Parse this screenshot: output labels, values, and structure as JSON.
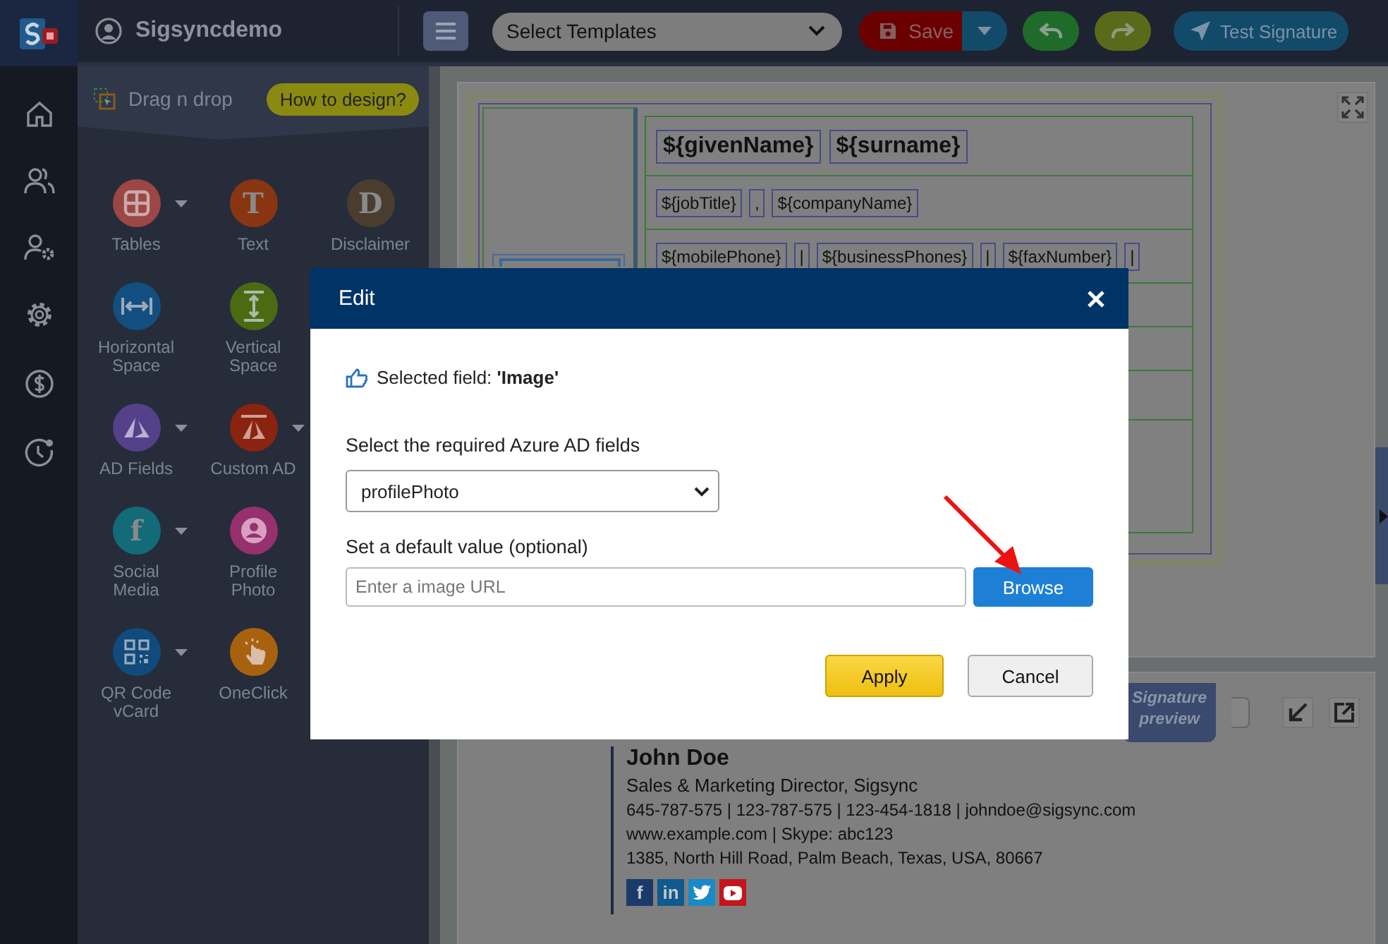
{
  "app": {
    "name": "Sigsyncdemo"
  },
  "toolbar": {
    "template_select": "Select Templates",
    "save": "Save",
    "test": "Test Signature"
  },
  "palette": {
    "title": "Drag n drop",
    "help": "How to design?",
    "items": [
      {
        "label": "Tables",
        "kind": "table",
        "color": "#9c4646",
        "has_menu": true
      },
      {
        "label": "Text",
        "kind": "glyph",
        "glyph": "T",
        "color": "#8a3512",
        "has_menu": false
      },
      {
        "label": "Disclaimer",
        "kind": "glyph",
        "glyph": "D",
        "color": "#4a3d30",
        "has_menu": false
      },
      {
        "label": "Horizontal Space",
        "kind": "horizontal",
        "color": "#124f80",
        "has_menu": false
      },
      {
        "label": "Vertical Space",
        "kind": "vertical",
        "color": "#4a6b12",
        "has_menu": false
      },
      {
        "label": "AD Fields",
        "kind": "azure",
        "color": "#54418a",
        "has_menu": true
      },
      {
        "label": "Custom AD",
        "kind": "custom-azure",
        "color": "#8a2410",
        "has_menu": true
      },
      {
        "label": "Social Media",
        "kind": "glyph",
        "glyph": "f",
        "color": "#136a78",
        "has_menu": true
      },
      {
        "label": "Profile Photo",
        "kind": "profile",
        "color": "#96306e",
        "has_menu": false
      },
      {
        "label": "QR Code vCard",
        "kind": "qr",
        "color": "#114a7c",
        "has_menu": true
      },
      {
        "label": "OneClick",
        "kind": "click",
        "color": "#a8620f",
        "has_menu": false
      }
    ]
  },
  "editor": {
    "rows": [
      {
        "kind": "name",
        "tokens": [
          "${givenName}",
          "${surname}"
        ]
      },
      {
        "kind": "detail",
        "tokens": [
          "${jobTitle}",
          ",",
          "${companyName}"
        ]
      },
      {
        "kind": "detail",
        "tokens": [
          "${mobilePhone}",
          "|",
          "${businessPhones}",
          "|",
          "${faxNumber}",
          "|"
        ]
      }
    ]
  },
  "modal": {
    "title": "Edit",
    "selected": "Selected field: **'Image'**",
    "select_label": "Select the required Azure AD fields",
    "select_value": "profilePhoto",
    "default_label": "Set a default value (optional)",
    "placeholder": "Enter a image URL",
    "browse": "Browse",
    "apply": "Apply",
    "cancel": "Cancel"
  },
  "preview": {
    "ribbon": "Signature preview",
    "name": "John Doe",
    "title": "Sales & Marketing Director, Sigsync",
    "lines": [
      "645-787-575 | 123-787-575 | 123-454-1818 | johndoe@sigsync.com",
      "www.example.com | Skype: abc123",
      "1385, North Hill Road, Palm Beach, Texas, USA, 80667"
    ],
    "social": [
      {
        "kind": "facebook",
        "glyph": "f",
        "color": "#1a3a6a"
      },
      {
        "kind": "linkedin",
        "glyph": "in",
        "color": "#0f5a8f"
      },
      {
        "kind": "twitter",
        "color": "#1a8ac6"
      },
      {
        "kind": "youtube",
        "color": "#c4161c"
      }
    ]
  }
}
